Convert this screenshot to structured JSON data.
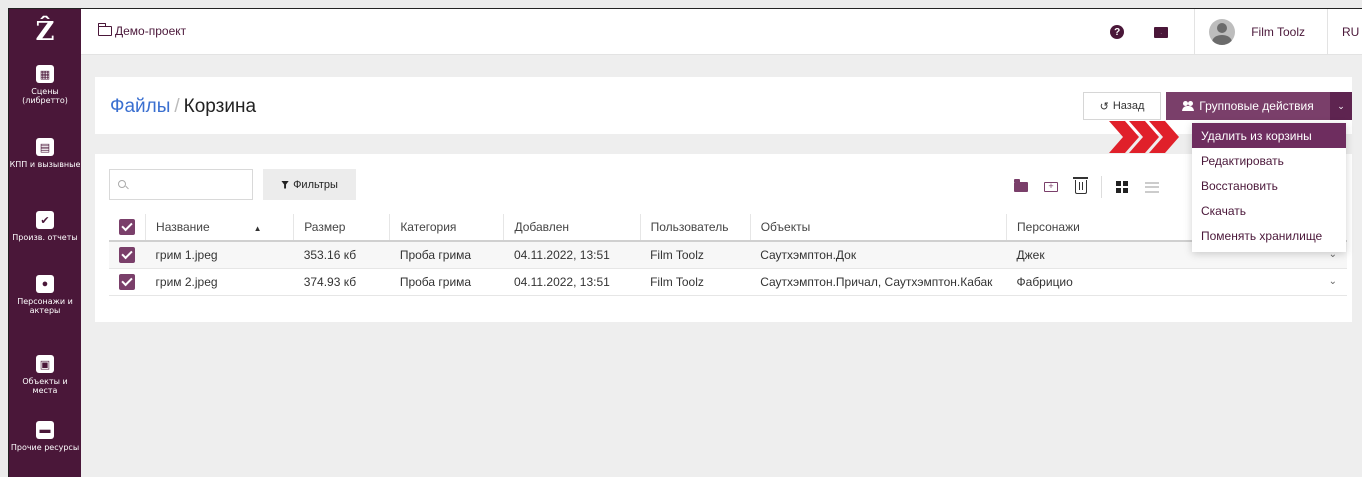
{
  "sidebar": {
    "logo": "Ẑ",
    "items": [
      {
        "label": "Сцены (либретто)",
        "icon": "scenes-icon",
        "glyph": "▦"
      },
      {
        "label": "КПП и вызывные",
        "icon": "calendar-icon",
        "glyph": "▤"
      },
      {
        "label": "Произв. отчеты",
        "icon": "check-icon",
        "glyph": "✔"
      },
      {
        "label": "Персонажи и актеры",
        "icon": "users-icon",
        "glyph": "●"
      },
      {
        "label": "Объекты и места",
        "icon": "image-icon",
        "glyph": "▣"
      },
      {
        "label": "Прочие ресурсы",
        "icon": "archive-icon",
        "glyph": "▬"
      }
    ]
  },
  "topbar": {
    "project": "Демо-проект",
    "help_glyph": "?",
    "user_name": "Film Toolz",
    "lang": "RU"
  },
  "header": {
    "title_link": "Файлы",
    "separator": "/",
    "title": "Корзина",
    "back_label": "Назад",
    "back_glyph": "↺",
    "group_label": "Групповые действия",
    "caret_glyph": "⌄"
  },
  "toolbar": {
    "search_placeholder": "",
    "filters_label": "Фильтры"
  },
  "table": {
    "columns": [
      "Название",
      "Размер",
      "Категория",
      "Добавлен",
      "Пользователь",
      "Объекты",
      "Персонажи"
    ],
    "rows": [
      {
        "name": "грим 1.jpeg",
        "size": "353.16 кб",
        "category": "Проба грима",
        "added": "04.11.2022, 13:51",
        "user": "Film Toolz",
        "objects": "Саутхэмптон.Док",
        "characters": "Джек"
      },
      {
        "name": "грим 2.jpeg",
        "size": "374.93 кб",
        "category": "Проба грима",
        "added": "04.11.2022, 13:51",
        "user": "Film Toolz",
        "objects": "Саутхэмптон.Причал, Саутхэмптон.Кабак",
        "characters": "Фабрицио"
      }
    ]
  },
  "dropdown": {
    "items": [
      "Удалить из корзины",
      "Редактировать",
      "Восстановить",
      "Скачать",
      "Поменять хранилище"
    ]
  },
  "colors": {
    "brand": "#4a1739",
    "accent": "#7a3f6a",
    "arrow": "#e0202a",
    "link": "#3a6fd0"
  }
}
